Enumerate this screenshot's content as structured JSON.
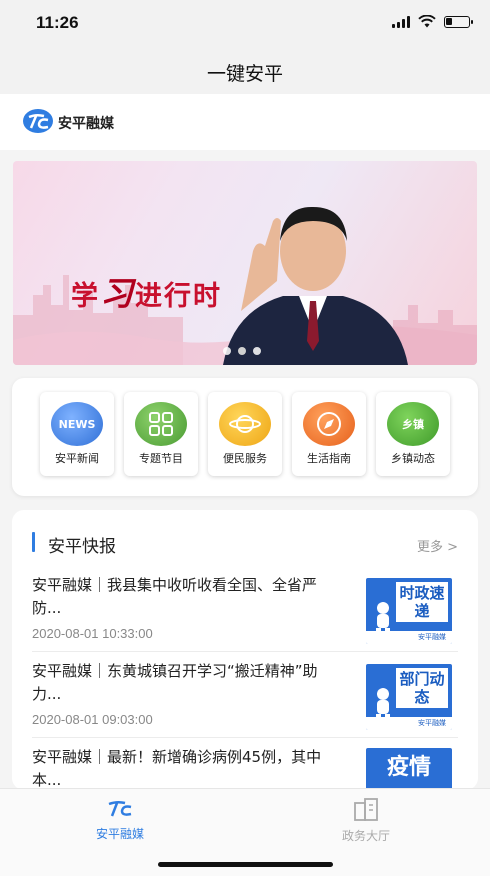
{
  "status_bar": {
    "time": "11:26",
    "battery_level": 0.3
  },
  "nav": {
    "title": "一键安平"
  },
  "brand": {
    "name": "安平融媒",
    "logo_icon": "ac-logo-icon"
  },
  "banner": {
    "text_prefix": "学",
    "text_highlight": "习",
    "text_suffix": "进行时",
    "slides": 3,
    "active_slide": 2
  },
  "services": [
    {
      "label": "安平新闻",
      "icon": "news-globe-icon",
      "color": "#3f7fe0",
      "icon_text": "NEWS"
    },
    {
      "label": "专题节目",
      "icon": "grid-icon",
      "color": "#5cae3f",
      "icon_text": ""
    },
    {
      "label": "便民服务",
      "icon": "planet-icon",
      "color": "#f2b21c",
      "icon_text": ""
    },
    {
      "label": "生活指南",
      "icon": "compass-icon",
      "color": "#f0742a",
      "icon_text": ""
    },
    {
      "label": "乡镇动态",
      "icon": "town-icon",
      "color": "#4aaa36",
      "icon_text": "乡镇"
    }
  ],
  "news": {
    "title": "安平快报",
    "more": "更多 >",
    "items": [
      {
        "title": "安平融媒｜我县集中收听收看全国、全省严防...",
        "date": "2020-08-01 10:33:00",
        "thumb": "时政速递"
      },
      {
        "title": "安平融媒｜东黄城镇召开学习“搬迁精神”助力...",
        "date": "2020-08-01 09:03:00",
        "thumb": "部门动态"
      },
      {
        "title": "安平融媒｜最新！新增确诊病例45例，其中本...",
        "date": "",
        "thumb": "疫情"
      }
    ],
    "thumb_footer": "安平融媒"
  },
  "tabs": [
    {
      "label": "安平融媒",
      "icon": "ac-logo-icon",
      "active": true
    },
    {
      "label": "政务大厅",
      "icon": "building-icon",
      "active": false
    }
  ]
}
